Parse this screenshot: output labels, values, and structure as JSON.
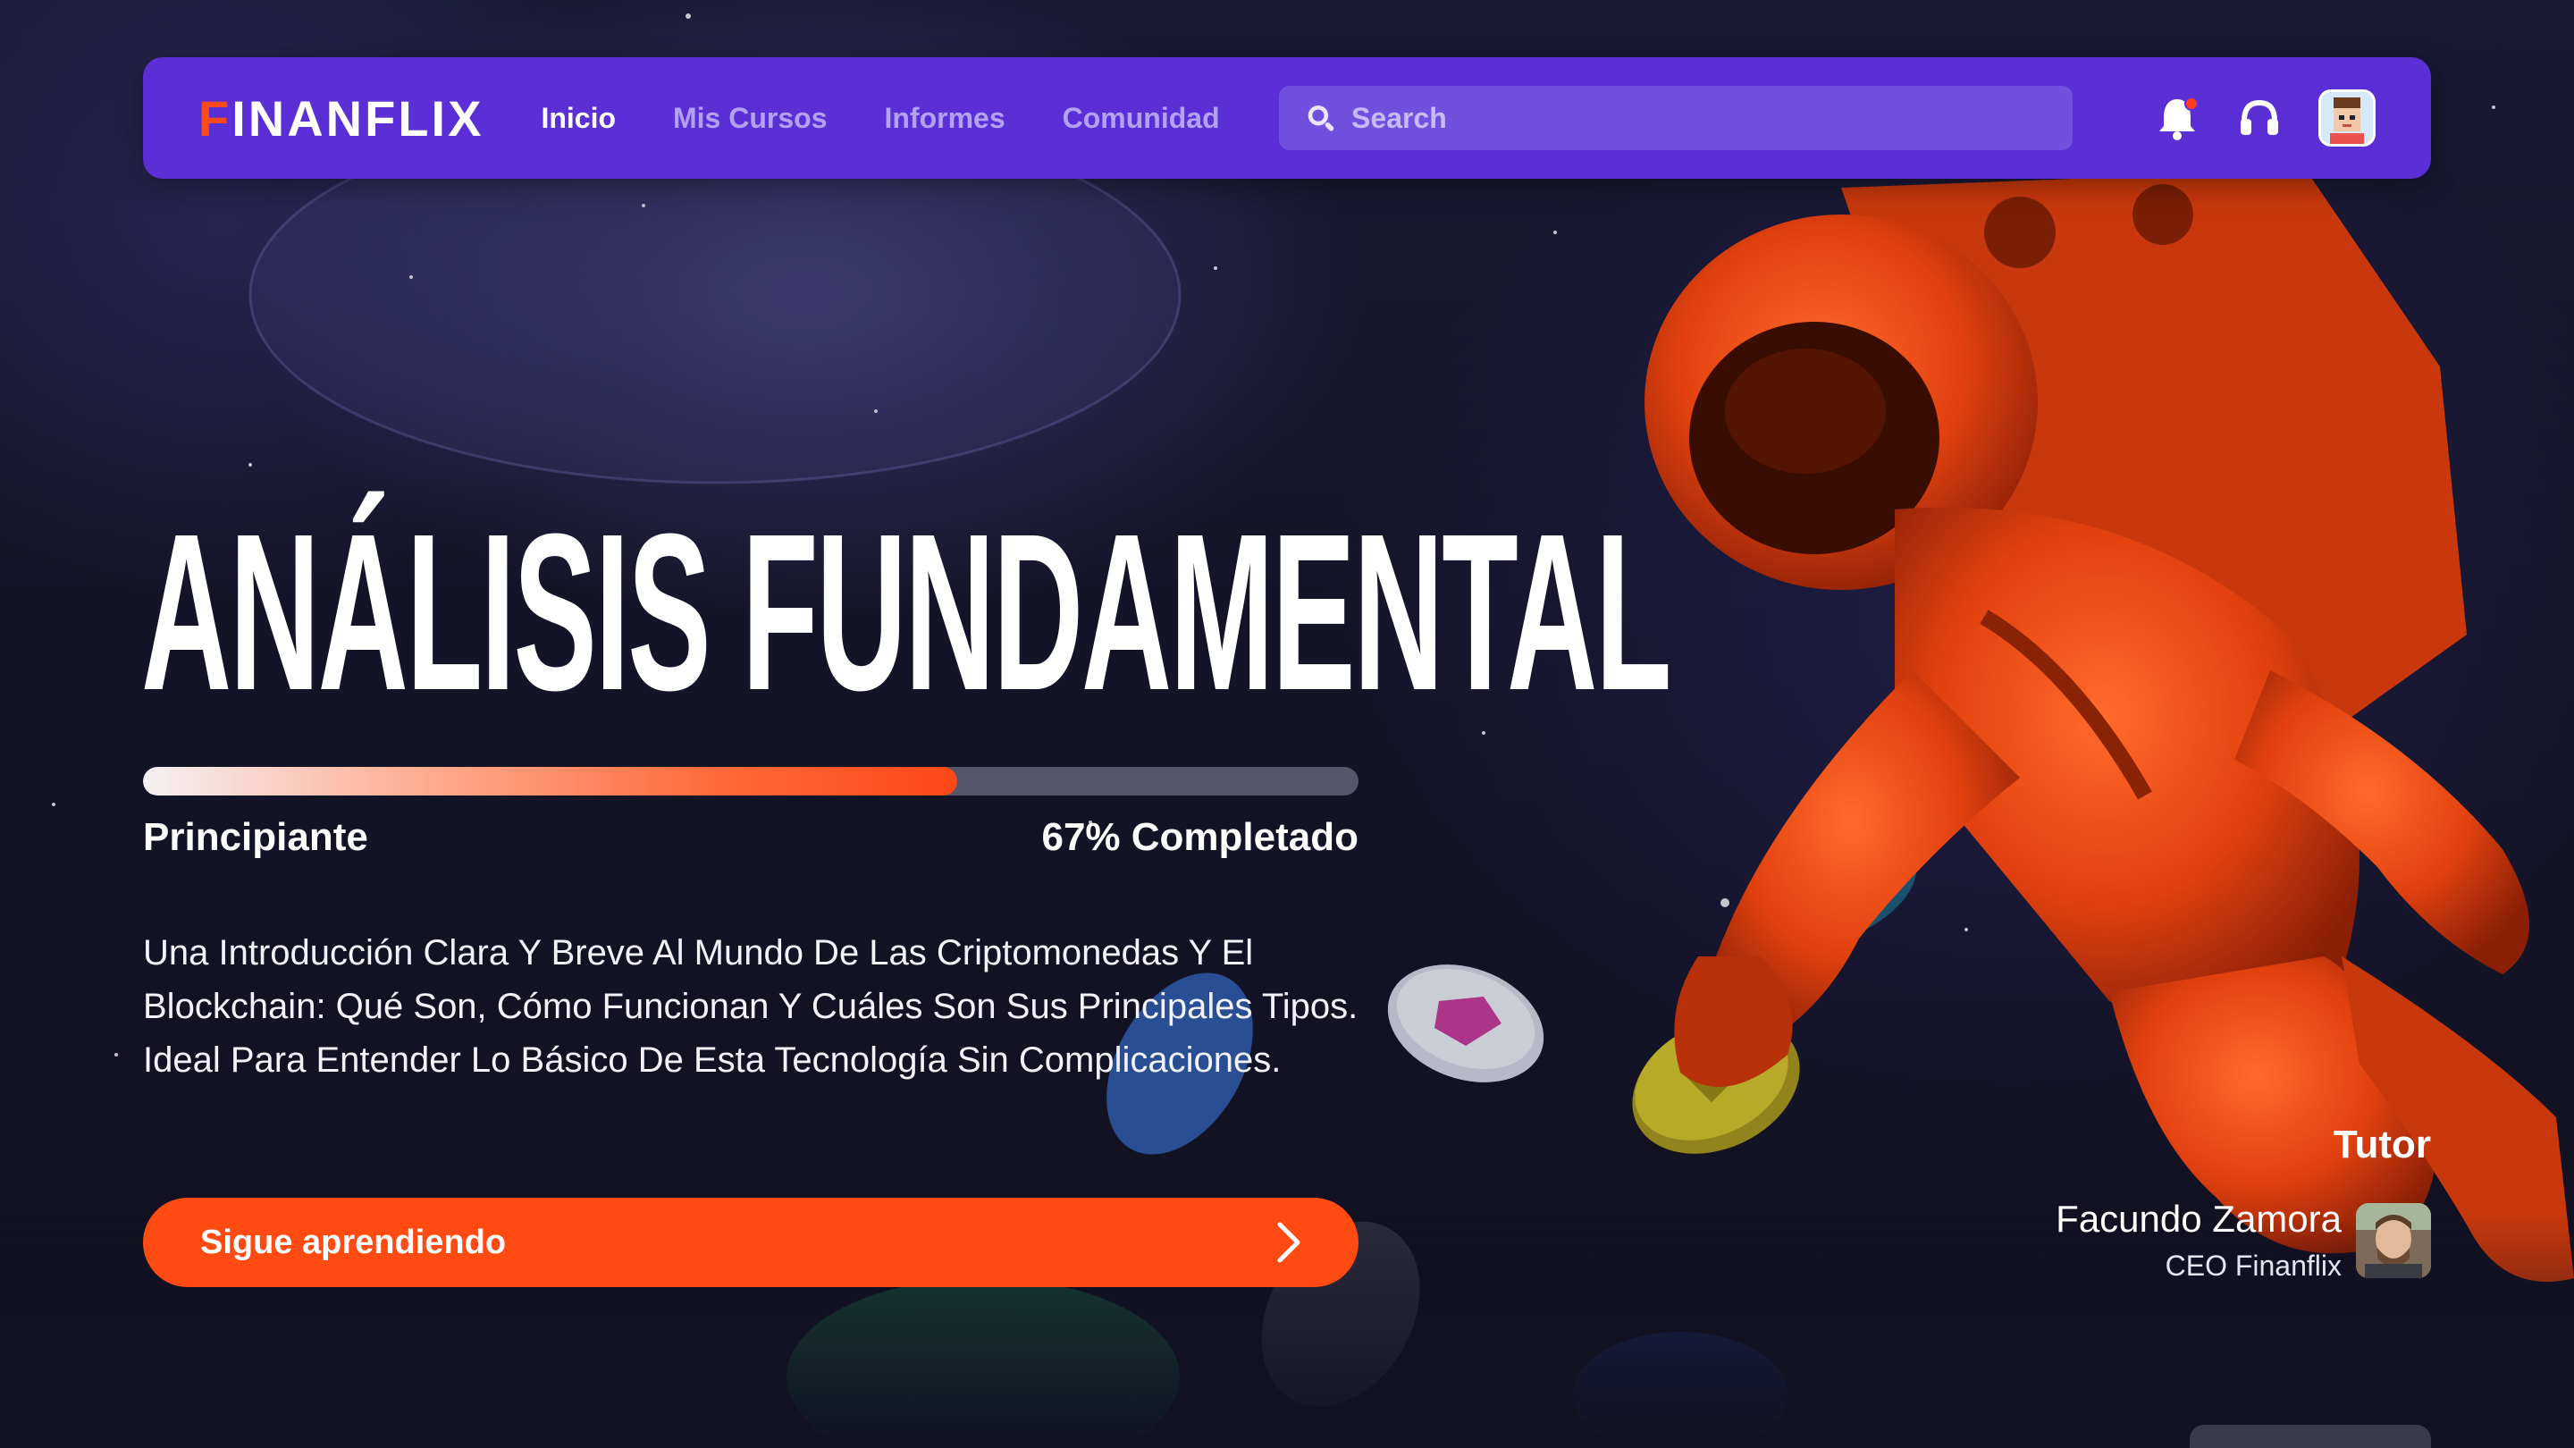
{
  "brand": {
    "logo_text": "FINANFLIX",
    "logo_first_letter": "F",
    "logo_rest": "INANFLIX"
  },
  "nav": {
    "items": [
      {
        "label": "Inicio",
        "active": true
      },
      {
        "label": "Mis Cursos",
        "active": false
      },
      {
        "label": "Informes",
        "active": false
      },
      {
        "label": "Comunidad",
        "active": false
      }
    ],
    "search_placeholder": "Search",
    "icons": [
      "bell-icon",
      "headset-icon",
      "avatar"
    ],
    "has_notification": true
  },
  "course": {
    "title": "ANÁLISIS FUNDAMENTAL",
    "level": "Principiante",
    "progress_percent": 67,
    "progress_label": "67% Completado",
    "description": "Una Introducción Clara Y Breve Al Mundo De Las Criptomonedas Y El Blockchain: Qué Son, Cómo Funcionan Y Cuáles Son Sus Principales Tipos. Ideal Para Entender Lo Básico De Esta Tecnología Sin Complicaciones.",
    "cta_label": "Sigue aprendiendo"
  },
  "tutor": {
    "heading": "Tutor",
    "name": "Facundo Zamora",
    "role": "CEO Finanflix"
  },
  "colors": {
    "navbar": "#5b2fd6",
    "accent": "#ff4a12",
    "search_bg": "#7150e0",
    "nav_inactive": "#b3a2f4"
  }
}
